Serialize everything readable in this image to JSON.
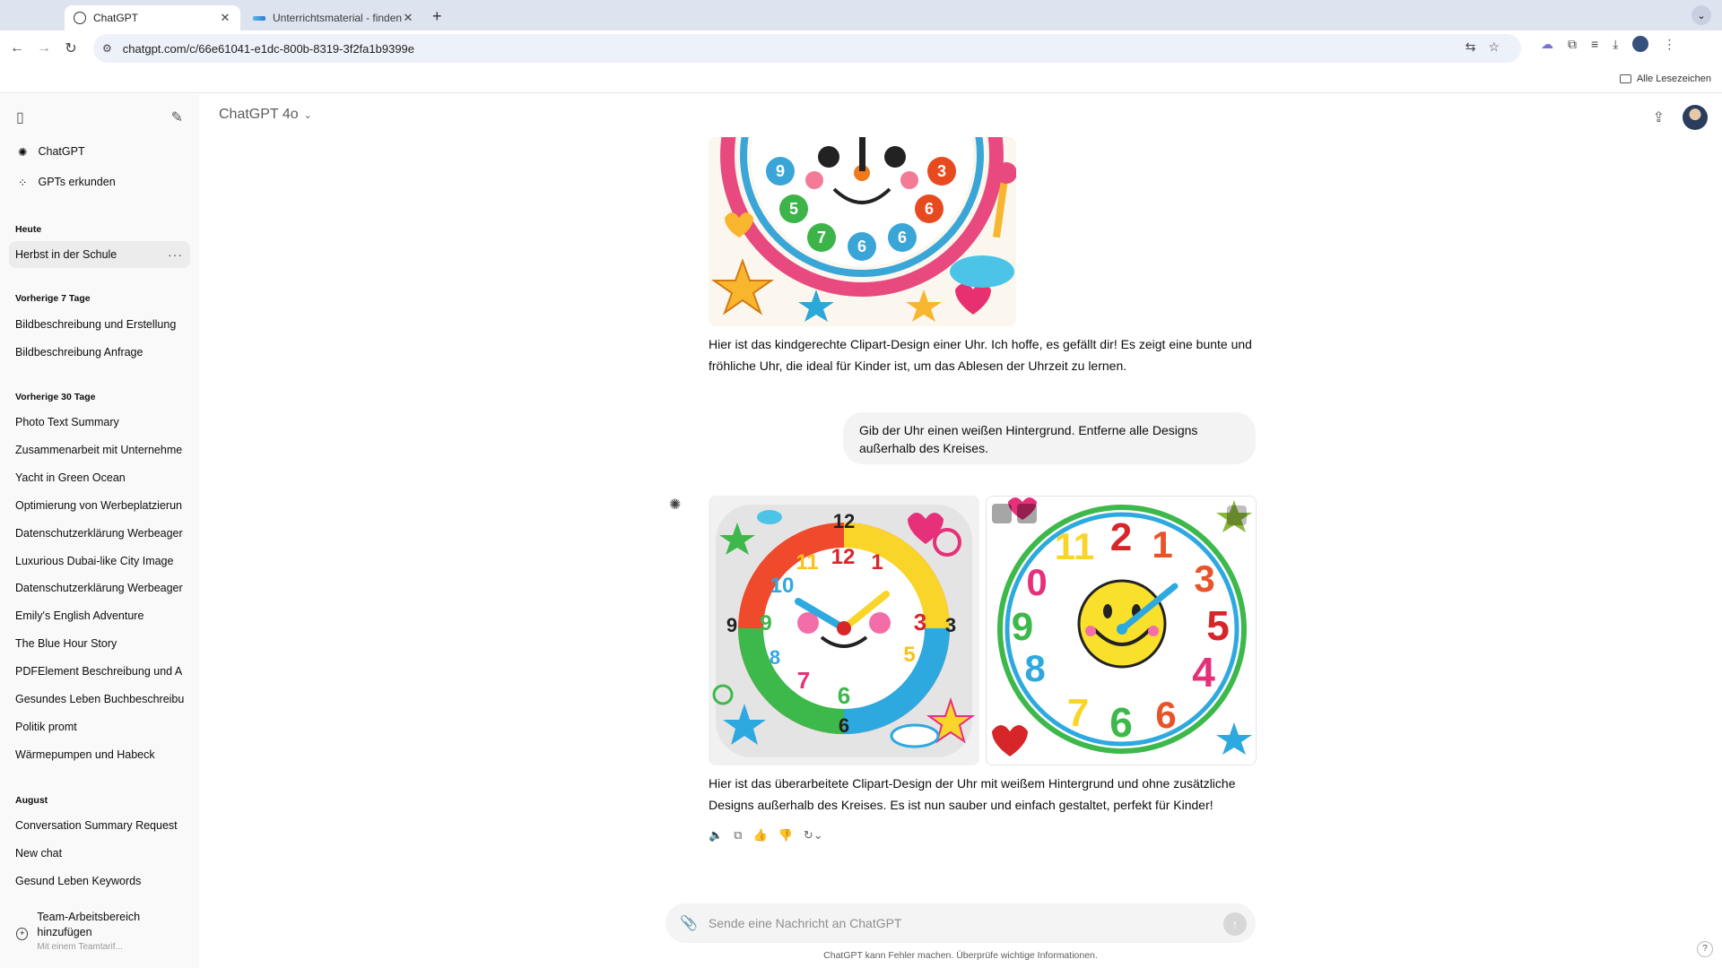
{
  "browser": {
    "tabs": [
      {
        "title": "ChatGPT",
        "close": "✕"
      },
      {
        "title": "Unterrichtsmaterial - finden &",
        "close": "✕"
      }
    ],
    "new_tab": "+",
    "url": "chatgpt.com/c/66e61041-e1dc-800b-8319-3f2fa1b9399e",
    "bookmarks_all": "Alle Lesezeichen"
  },
  "sidebar": {
    "links": [
      {
        "label": "ChatGPT",
        "icon": "openai-logo-icon"
      },
      {
        "label": "GPTs erkunden",
        "icon": "grid-icon"
      }
    ],
    "sections": [
      {
        "title": "Heute",
        "items": [
          "Herbst in der Schule"
        ]
      },
      {
        "title": "Vorherige 7 Tage",
        "items": [
          "Bildbeschreibung und Erstellung",
          "Bildbeschreibung Anfrage"
        ]
      },
      {
        "title": "Vorherige 30 Tage",
        "items": [
          "Photo Text Summary",
          "Zusammenarbeit mit Unternehme",
          "Yacht in Green Ocean",
          "Optimierung von Werbeplatzierun",
          "Datenschutzerklärung Werbeager",
          "Luxurious Dubai-like City Image",
          "Datenschutzerklärung Werbeager",
          "Emily's English Adventure",
          "The Blue Hour Story",
          "PDFElement Beschreibung und A",
          "Gesundes Leben Buchbeschreibu",
          "Politik promt",
          "Wärmepumpen und Habeck"
        ]
      },
      {
        "title": "August",
        "items": [
          "Conversation Summary Request",
          "New chat",
          "Gesund Leben Keywords"
        ]
      }
    ],
    "more_dots": "···",
    "team": {
      "title": "Team-Arbeitsbereich hinzufügen",
      "subtitle": "Mit einem Teamtarif..."
    }
  },
  "header": {
    "model": "ChatGPT 4o"
  },
  "conversation": {
    "first_response": "Hier ist das kindgerechte Clipart-Design einer Uhr. Ich hoffe, es gefällt dir! Es zeigt eine bunte und fröhliche Uhr, die ideal für Kinder ist, um das Ablesen der Uhrzeit zu lernen.",
    "user_message": "Gib der Uhr einen weißen Hintergrund. Entferne alle Designs außerhalb des Kreises.",
    "second_response": "Hier ist das überarbeitete Clipart-Design der Uhr mit weißem Hintergrund und ohne zusätzliche Designs außerhalb des Kreises. Es ist nun sauber und einfach gestaltet, perfekt für Kinder!",
    "clock_left_numbers": [
      "12",
      "1",
      "3",
      "5",
      "6",
      "7",
      "8",
      "9",
      "10",
      "11",
      "3",
      "9",
      "6"
    ],
    "clock_right_numbers": [
      "2",
      "1",
      "3",
      "5",
      "4",
      "6",
      "6",
      "7",
      "8",
      "9",
      "0",
      "11"
    ],
    "first_image_numbers": [
      "9",
      "3",
      "5",
      "6",
      "7",
      "6",
      "6"
    ]
  },
  "composer": {
    "placeholder": "Sende eine Nachricht an ChatGPT"
  },
  "footer": {
    "disclaimer": "ChatGPT kann Fehler machen. Überprüfe wichtige Informationen.",
    "help": "?"
  }
}
